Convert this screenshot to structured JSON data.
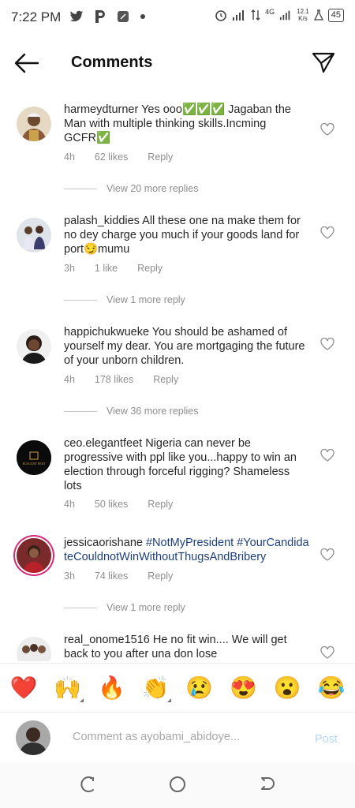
{
  "status_bar": {
    "time": "7:22 PM",
    "network_speed_value": "12.1",
    "network_speed_unit": "K/s",
    "network_type": "4G",
    "battery": "45"
  },
  "header": {
    "title": "Comments"
  },
  "comments": [
    {
      "username": "harmeydturner",
      "text": " Yes ooo✅✅✅ Jagaban the Man with multiple thinking skills.Incming GCFR✅",
      "time": "4h",
      "likes": "62 likes",
      "reply": "Reply",
      "view_more": "View 20 more replies"
    },
    {
      "username": "palash_kiddies",
      "text": " All these one na make them for no dey charge you much if your goods land for port😏mumu",
      "time": "3h",
      "likes": "1 like",
      "reply": "Reply",
      "view_more": "View 1 more reply"
    },
    {
      "username": "happichukwueke",
      "text": " You should be ashamed of yourself my dear. You are mortgaging the future of your unborn children.",
      "time": "4h",
      "likes": "178 likes",
      "reply": "Reply",
      "view_more": "View 36 more replies"
    },
    {
      "username": "ceo.elegantfeet",
      "text": " Nigeria can never be progressive with ppl like you...happy to win an election through forceful rigging? Shameless lots",
      "time": "4h",
      "likes": "50 likes",
      "reply": "Reply",
      "avatar_text": "ELEGANT FEET"
    },
    {
      "username": "jessicaorishane",
      "hashtags": " #NotMyPresident #YourCandidateCouldnotWinWithoutThugsAndBribery",
      "time": "3h",
      "likes": "74 likes",
      "reply": "Reply",
      "view_more": "View 1 more reply"
    },
    {
      "username": "real_onome1516",
      "text": " He no fit win.... We will get back to you after una don lose"
    }
  ],
  "emojis": [
    "❤️",
    "🙌",
    "🔥",
    "👏",
    "😢",
    "😍",
    "😮",
    "😂"
  ],
  "composer": {
    "placeholder": "Comment as ayobami_abidoye...",
    "post_label": "Post"
  },
  "colors": {
    "accent_disabled": "#b3d7f7",
    "hashtag": "#1c3f7a",
    "meta": "#8e8e8e"
  }
}
